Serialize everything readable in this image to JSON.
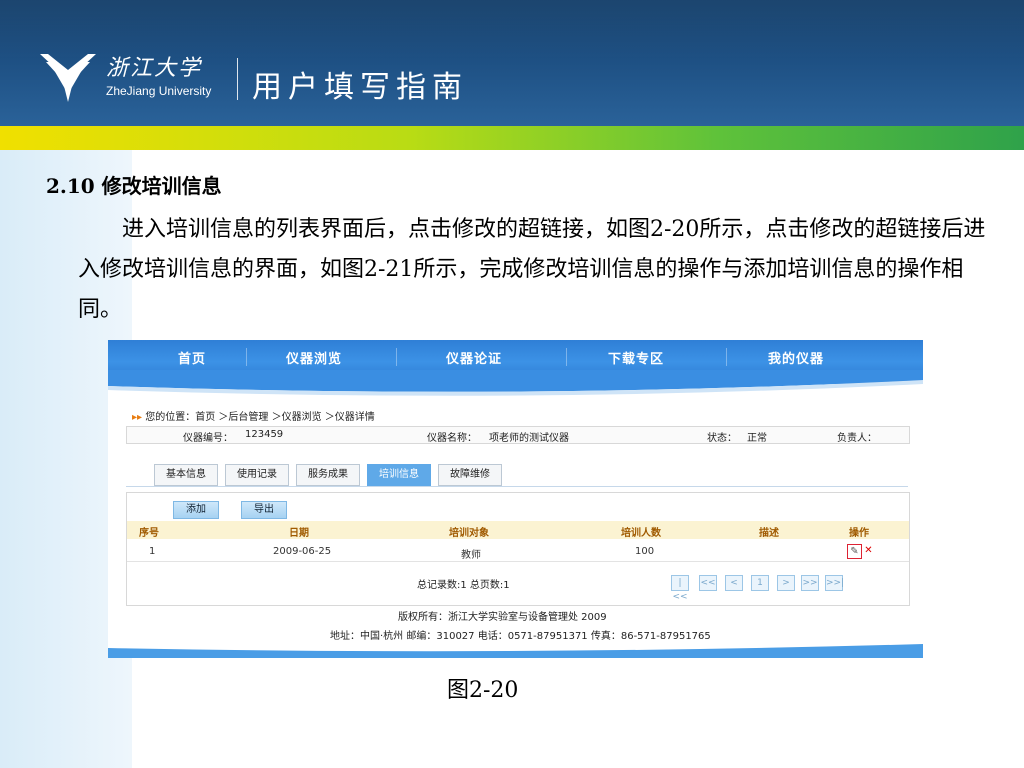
{
  "header": {
    "logo_cn": "浙江大学",
    "logo_en": "ZheJiang University",
    "title": "用户填写指南",
    "colors": {
      "dark_blue": "#0e3a66",
      "stripe_yellow": "#f0e000",
      "stripe_green": "#2fa24a"
    }
  },
  "content": {
    "section_title": "2.10 修改培训信息",
    "paragraph": "进入培训信息的列表界面后，点击修改的超链接，如图2-20所示，点击修改的超链接后进入修改培训信息的界面，如图2-21所示，完成修改培训信息的操作与添加培训信息的操作相同。",
    "caption": "图2-20"
  },
  "screenshot": {
    "nav": [
      "首页",
      "仪器浏览",
      "仪器论证",
      "下载专区",
      "我的仪器"
    ],
    "breadcrumb": "您的位置：首页 ＞后台管理 ＞仪器浏览 ＞仪器详情",
    "info": {
      "number_label": "仪器编号：",
      "number_value": "123459",
      "name_label": "仪器名称：",
      "name_value": "项老师的测试仪器",
      "status_label": "状态：",
      "status_value": "正常",
      "owner_label": "负责人："
    },
    "tabs": [
      "基本信息",
      "使用记录",
      "服务成果",
      "培训信息",
      "故障维修"
    ],
    "active_tab": "培训信息",
    "buttons": {
      "add": "添加",
      "export": "导出"
    },
    "table": {
      "headers": [
        "序号",
        "日期",
        "培训对象",
        "培训人数",
        "描述",
        "操作"
      ],
      "rows": [
        {
          "index": "1",
          "date": "2009-06-25",
          "target": "教师",
          "count": "100",
          "desc": ""
        }
      ]
    },
    "actions": {
      "edit_icon": "pencil-icon",
      "delete_icon": "close-icon"
    },
    "summary": "总记录数:1 总页数:1",
    "pager": [
      "|<<",
      "<<",
      "<",
      "1",
      ">",
      ">>",
      ">>|"
    ],
    "footer": {
      "copyright": "版权所有：浙江大学实验室与设备管理处 2009",
      "address": "地址：中国·杭州 邮编：310027 电话：0571-87951371 传真：86-571-87951765"
    }
  }
}
